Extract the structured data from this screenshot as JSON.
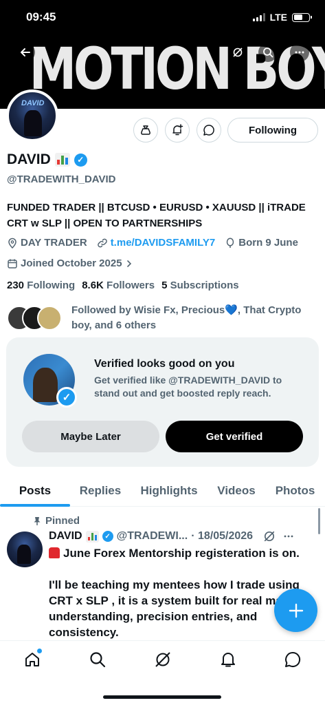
{
  "status_bar": {
    "time": "09:45",
    "network": "LTE",
    "battery_level": 0.6
  },
  "banner": {
    "text": "MOTION BOY"
  },
  "profile": {
    "avatar_text": "DAVID",
    "name": "DAVID",
    "handle": "@TRADEWITH_DAVID",
    "bio": "FUNDED TRADER || BTCUSD • EURUSD • XAUUSD || iTRADE CRT w SLP || OPEN TO PARTNERSHIPS",
    "category": "DAY TRADER",
    "link": "t.me/DAVIDSFAMILY7",
    "born": "Born 9 June",
    "joined": "Joined October 2025",
    "following_count": "230",
    "following_label": "Following",
    "followers_count": "8.6K",
    "followers_label": "Followers",
    "subscriptions_count": "5",
    "subscriptions_label": "Subscriptions",
    "followed_by": "Followed by Wisie Fx, Precious💙, That Crypto boy, and 6 others",
    "following_button": "Following"
  },
  "verify_card": {
    "title": "Verified looks good on you",
    "subtitle": "Get verified like @TRADEWITH_DAVID to stand out and get boosted reply reach.",
    "later_label": "Maybe Later",
    "get_label": "Get verified"
  },
  "tabs": [
    "Posts",
    "Replies",
    "Highlights",
    "Videos",
    "Photos"
  ],
  "post": {
    "pinned_label": "Pinned",
    "author": "DAVID",
    "handle": "@TRADEWI...",
    "date": "· 18/05/2026",
    "line1": "June Forex Mentorship registeration is on.",
    "line2": "I'll be teaching my mentees how I trade using CRT x SLP , it is a system built for real ma understanding, precision entries, and consistency."
  },
  "icons": {
    "back": "arrow-left-icon",
    "grok": "grok-icon",
    "search": "search-icon",
    "more": "more-icon",
    "money": "money-bag-icon",
    "notify": "bell-plus-icon",
    "message": "message-icon",
    "fab": "plus-icon"
  },
  "colors": {
    "accent": "#1d9bf0",
    "text": "#0f1419",
    "muted": "#536471"
  }
}
